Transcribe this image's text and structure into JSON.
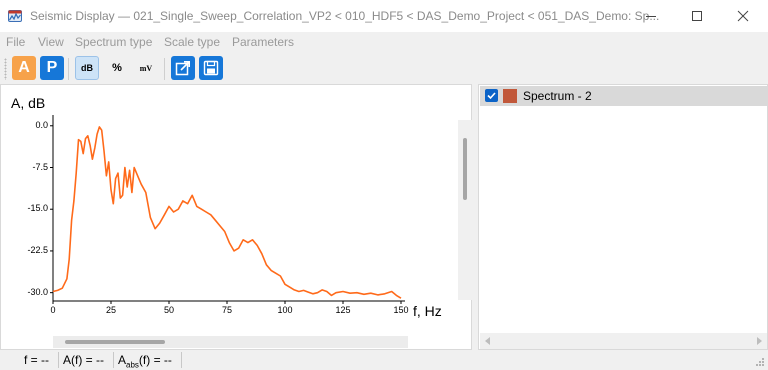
{
  "window": {
    "title": "Seismic Display — 021_Single_Sweep_Correlation_VP2 < 010_HDF5 < DAS_Demo_Project < 051_DAS_Demo: Sp...",
    "minimize_icon": "minimize-icon",
    "maximize_icon": "maximize-icon",
    "close_icon": "close-icon"
  },
  "menu": [
    "File",
    "View",
    "Spectrum type",
    "Scale type",
    "Parameters"
  ],
  "toolbar": {
    "btn_a": "A",
    "btn_p": "P",
    "btn_db": "dB",
    "btn_percent": "%",
    "btn_mv": "mV",
    "export_icon": "external-link-icon",
    "save_icon": "save-image-icon",
    "active_color": "#f7a24a",
    "blue_color": "#1677d8"
  },
  "plot": {
    "ylabel": "A, dB",
    "xlabel": "f, Hz",
    "line_color": "#ff6a1a"
  },
  "legend": {
    "items": [
      {
        "label": "Spectrum - 2",
        "color": "#c1583a",
        "checked": true
      }
    ]
  },
  "status": {
    "f_label": "f = --",
    "a_label": "A(f) = --",
    "aabs_prefix": "A",
    "aabs_sub": "abs",
    "aabs_suffix": "(f) = --"
  },
  "chart_data": {
    "type": "line",
    "xlabel": "f, Hz",
    "ylabel": "A, dB",
    "xlim": [
      0,
      150
    ],
    "ylim": [
      -31.5,
      0.5
    ],
    "xticks": [
      0,
      25,
      50,
      75,
      100,
      125,
      150
    ],
    "yticks": [
      0.0,
      -7.5,
      -15.0,
      -22.5,
      -30.0
    ],
    "ytick_labels": [
      "0.0",
      "-7.5",
      "-15.0",
      "-22.5",
      "-30.0"
    ],
    "series": [
      {
        "x": [
          0,
          2,
          4,
          6,
          7,
          8,
          9,
          10,
          11,
          12,
          13,
          14,
          15,
          16,
          17,
          18,
          19,
          20,
          21,
          22,
          23,
          24,
          25,
          26,
          27,
          28,
          29,
          30,
          31,
          32,
          33,
          34,
          35,
          36,
          37,
          38,
          40,
          42,
          44,
          46,
          48,
          50,
          52,
          54,
          56,
          58,
          60,
          62,
          64,
          66,
          68,
          70,
          72,
          74,
          76,
          78,
          80,
          82,
          84,
          86,
          88,
          90,
          92,
          94,
          96,
          98,
          100,
          102,
          104,
          106,
          108,
          110,
          112,
          114,
          116,
          118,
          120,
          122,
          125,
          128,
          131,
          134,
          137,
          140,
          143,
          146,
          148,
          150
        ],
        "y": [
          -29.8,
          -29.6,
          -29.2,
          -27.5,
          -24.0,
          -17.0,
          -13.5,
          -8.5,
          -2.5,
          -2.8,
          -5.0,
          -2.3,
          -1.8,
          -3.5,
          -6.0,
          -4.0,
          -1.5,
          -0.2,
          -0.8,
          -4.5,
          -9.0,
          -6.5,
          -11.5,
          -14.0,
          -9.5,
          -8.5,
          -13.0,
          -12.5,
          -7.5,
          -11.0,
          -8.0,
          -12.0,
          -7.5,
          -8.5,
          -9.5,
          -10.5,
          -12.0,
          -16.5,
          -18.5,
          -17.5,
          -16.0,
          -14.5,
          -15.5,
          -15.0,
          -13.5,
          -14.0,
          -12.5,
          -14.5,
          -15.0,
          -15.5,
          -16.0,
          -17.0,
          -18.0,
          -19.0,
          -21.0,
          -22.5,
          -22.0,
          -20.5,
          -21.0,
          -20.5,
          -21.5,
          -23.0,
          -25.0,
          -26.0,
          -26.5,
          -27.0,
          -28.5,
          -29.0,
          -29.5,
          -29.8,
          -29.6,
          -29.9,
          -30.2,
          -30.0,
          -29.5,
          -29.8,
          -30.5,
          -30.0,
          -29.8,
          -30.1,
          -30.0,
          -30.3,
          -30.1,
          -30.4,
          -30.2,
          -29.8,
          -30.5,
          -31.0
        ]
      }
    ]
  }
}
